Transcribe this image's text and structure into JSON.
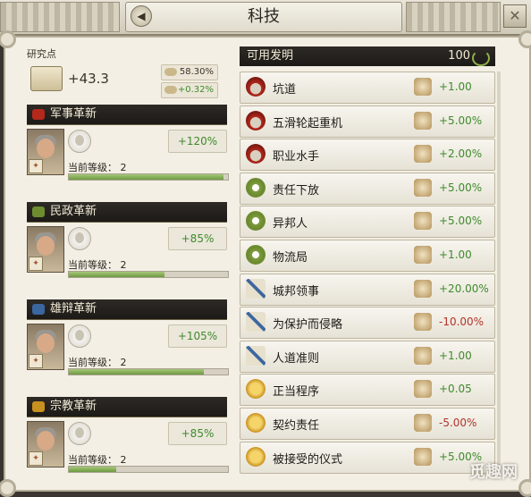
{
  "window": {
    "title": "科技",
    "back_icon": "arrow-left-icon",
    "close_icon": "close-icon"
  },
  "research": {
    "label": "研究点",
    "value": "+43.3",
    "rates": [
      {
        "icon": "quill-icon",
        "value": "58.30%"
      },
      {
        "icon": "scroll-icon",
        "value": "+0.32%"
      }
    ]
  },
  "categories": [
    {
      "name": "军事革新",
      "icon": "helmet-icon",
      "bonus": "+120%",
      "level_label": "当前等级：",
      "level": "2",
      "progress": 0.97,
      "color": "#b5281c"
    },
    {
      "name": "民政革新",
      "icon": "laurel-icon",
      "bonus": "+85%",
      "level_label": "当前等级：",
      "level": "2",
      "progress": 0.6,
      "color": "#6d8c30"
    },
    {
      "name": "雄辩革新",
      "icon": "quill-icon",
      "bonus": "+105%",
      "level_label": "当前等级：",
      "level": "2",
      "progress": 0.85,
      "color": "#3b66a0"
    },
    {
      "name": "宗教革新",
      "icon": "sun-icon",
      "bonus": "+85%",
      "level_label": "当前等级：",
      "level": "2",
      "progress": 0.3,
      "color": "#c8901e"
    }
  ],
  "inventions": {
    "title": "可用发明",
    "count": "100",
    "items": [
      {
        "name": "坑道",
        "type": "military",
        "effect": "+1.00",
        "sign": "pos"
      },
      {
        "name": "五滑轮起重机",
        "type": "military",
        "effect": "+5.00%",
        "sign": "pos"
      },
      {
        "name": "职业水手",
        "type": "military",
        "effect": "+2.00%",
        "sign": "pos"
      },
      {
        "name": "责任下放",
        "type": "civic",
        "effect": "+5.00%",
        "sign": "pos"
      },
      {
        "name": "异邦人",
        "type": "civic",
        "effect": "+5.00%",
        "sign": "pos"
      },
      {
        "name": "物流局",
        "type": "civic",
        "effect": "+1.00",
        "sign": "pos"
      },
      {
        "name": "城邦领事",
        "type": "sci",
        "effect": "+20.00%",
        "sign": "pos"
      },
      {
        "name": "为保护而侵略",
        "type": "sci",
        "effect": "-10.00%",
        "sign": "neg"
      },
      {
        "name": "人道准则",
        "type": "sci",
        "effect": "+1.00",
        "sign": "pos"
      },
      {
        "name": "正当程序",
        "type": "rel",
        "effect": "+0.05",
        "sign": "pos"
      },
      {
        "name": "契约责任",
        "type": "rel",
        "effect": "-5.00%",
        "sign": "neg"
      },
      {
        "name": "被接受的仪式",
        "type": "rel",
        "effect": "+5.00%",
        "sign": "pos"
      }
    ]
  },
  "watermark": "觅趣网"
}
